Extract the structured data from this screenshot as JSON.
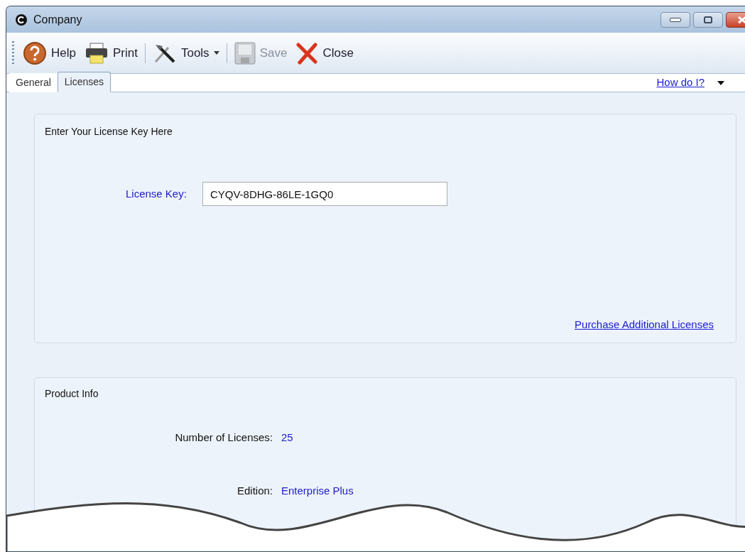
{
  "window": {
    "title": "Company"
  },
  "toolbar": [
    {
      "kind": "button",
      "label": "Help",
      "disabled": false
    },
    {
      "kind": "button",
      "label": "Print",
      "disabled": false
    },
    {
      "kind": "separator"
    },
    {
      "kind": "dropdown",
      "label": "Tools",
      "disabled": false
    },
    {
      "kind": "separator"
    },
    {
      "kind": "button",
      "label": "Save",
      "disabled": true
    },
    {
      "kind": "button",
      "label": "Close",
      "disabled": false
    }
  ],
  "tabs": [
    {
      "label": "General",
      "selected": false
    },
    {
      "label": "Licenses",
      "selected": true
    }
  ],
  "help_link": "How do I?",
  "license_group": {
    "title": "Enter Your License Key Here",
    "field_label": "License Key:",
    "value": "CYQV-8DHG-86LE-1GQ0",
    "link": "Purchase Additional Licenses"
  },
  "product_info": {
    "title": "Product Info",
    "rows": [
      {
        "label": "Number of Licenses:",
        "value": "25"
      },
      {
        "label": "Edition:",
        "value": "Enterprise Plus"
      }
    ]
  }
}
